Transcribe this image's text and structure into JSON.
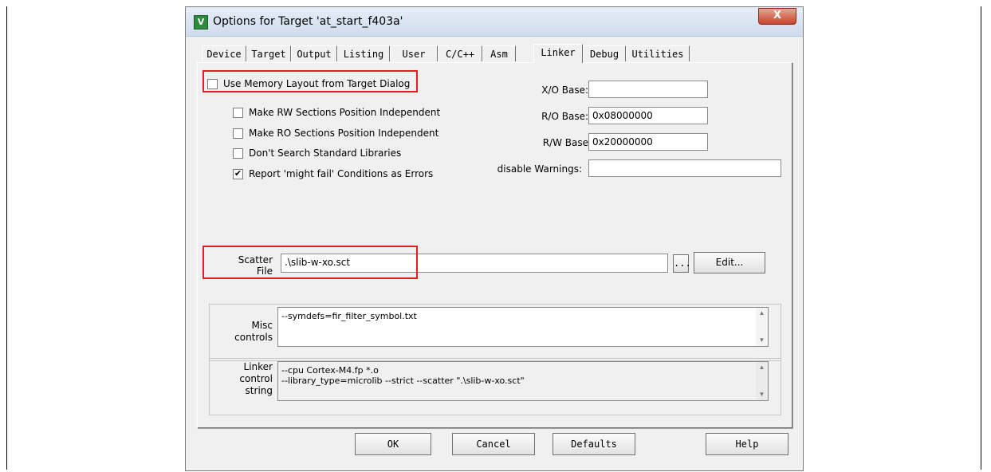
{
  "window": {
    "title": "Options for Target 'at_start_f403a'",
    "icon_glyph": "V",
    "close_glyph": "X"
  },
  "tabs": [
    {
      "label": "Device"
    },
    {
      "label": "Target"
    },
    {
      "label": "Output"
    },
    {
      "label": "Listing"
    },
    {
      "label": "User"
    },
    {
      "label": "C/C++"
    },
    {
      "label": "Asm"
    },
    {
      "label": "Linker"
    },
    {
      "label": "Debug"
    },
    {
      "label": "Utilities"
    }
  ],
  "active_tab": "Linker",
  "options": {
    "use_memory_layout": {
      "label": "Use Memory Layout from Target Dialog",
      "checked": false,
      "mark": ""
    },
    "rw_independent": {
      "label": "Make RW Sections Position Independent",
      "checked": false,
      "mark": ""
    },
    "ro_independent": {
      "label": "Make RO Sections Position Independent",
      "checked": false,
      "mark": ""
    },
    "dont_search_libs": {
      "label": "Don't Search Standard Libraries",
      "checked": false,
      "mark": ""
    },
    "report_might_fail": {
      "label": "Report 'might fail' Conditions as Errors",
      "checked": true,
      "mark": "✔"
    }
  },
  "fields": {
    "xo_base": {
      "label": "X/O Base:",
      "value": ""
    },
    "ro_base": {
      "label": "R/O Base:",
      "value": "0x08000000"
    },
    "rw_base": {
      "label": "R/W Base",
      "value": "0x20000000"
    },
    "disable_warnings": {
      "label": "disable Warnings:",
      "value": ""
    }
  },
  "scatter": {
    "label_line1": "Scatter",
    "label_line2": "File",
    "value": ".\\slib-w-xo.sct",
    "browse_label": "...",
    "edit_label": "Edit..."
  },
  "misc": {
    "label_line1": "Misc",
    "label_line2": "controls",
    "value": "--symdefs=fir_filter_symbol.txt"
  },
  "linker_string": {
    "label_line1": "Linker",
    "label_line2": "control",
    "label_line3": "string",
    "value": "--cpu Cortex-M4.fp *.o\n--library_type=microlib --strict --scatter \".\\slib-w-xo.sct\""
  },
  "buttons": {
    "ok": "OK",
    "cancel": "Cancel",
    "defaults": "Defaults",
    "help": "Help"
  },
  "scroll_up_glyph": "▲",
  "scroll_down_glyph": "▼",
  "colors": {
    "highlight": "#e02020"
  }
}
